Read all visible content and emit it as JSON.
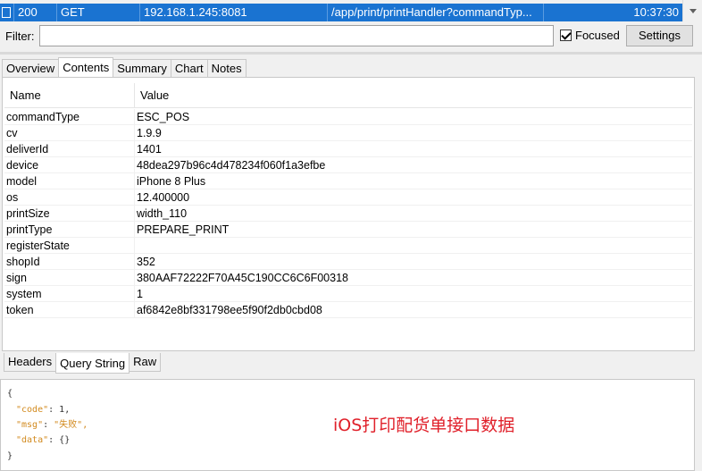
{
  "request": {
    "status": "200",
    "method": "GET",
    "host": "192.168.1.245:8081",
    "url": "/app/print/printHandler?commandTyp...",
    "time": "10:37:30"
  },
  "filter": {
    "label": "Filter:",
    "value": "",
    "focused_label": "Focused",
    "focused_checked": true,
    "settings_label": "Settings"
  },
  "top_tabs": [
    "Overview",
    "Contents",
    "Summary",
    "Chart",
    "Notes"
  ],
  "active_top_tab": "Contents",
  "table": {
    "columns": [
      "Name",
      "Value"
    ],
    "rows": [
      {
        "name": "commandType",
        "value": "ESC_POS"
      },
      {
        "name": "cv",
        "value": "1.9.9"
      },
      {
        "name": "deliverId",
        "value": "1401"
      },
      {
        "name": "device",
        "value": "48dea297b96c4d478234f060f1a3efbe"
      },
      {
        "name": "model",
        "value": "iPhone 8 Plus"
      },
      {
        "name": "os",
        "value": "12.400000"
      },
      {
        "name": "printSize",
        "value": "width_110"
      },
      {
        "name": "printType",
        "value": "PREPARE_PRINT"
      },
      {
        "name": "registerState",
        "value": ""
      },
      {
        "name": "shopId",
        "value": "352"
      },
      {
        "name": "sign",
        "value": "380AAF72222F70A45C190CC6C6F00318"
      },
      {
        "name": "system",
        "value": "1"
      },
      {
        "name": "token",
        "value": "af6842e8bf331798ee5f90f2db0cbd08"
      }
    ]
  },
  "bottom_tabs": [
    "Headers",
    "Query String",
    "Raw"
  ],
  "active_bottom_tab": "Query String",
  "response": {
    "open": "{",
    "code_key": "\"code\"",
    "code_val": "1,",
    "msg_key": "\"msg\"",
    "msg_val": "\"失败\",",
    "data_key": "\"data\"",
    "data_val": "{}",
    "close": "}"
  },
  "annotation": "iOS打印配货单接口数据",
  "colors": {
    "selection": "#1a73d1",
    "annotation": "#e0202a",
    "json_key": "#d28a1e"
  }
}
